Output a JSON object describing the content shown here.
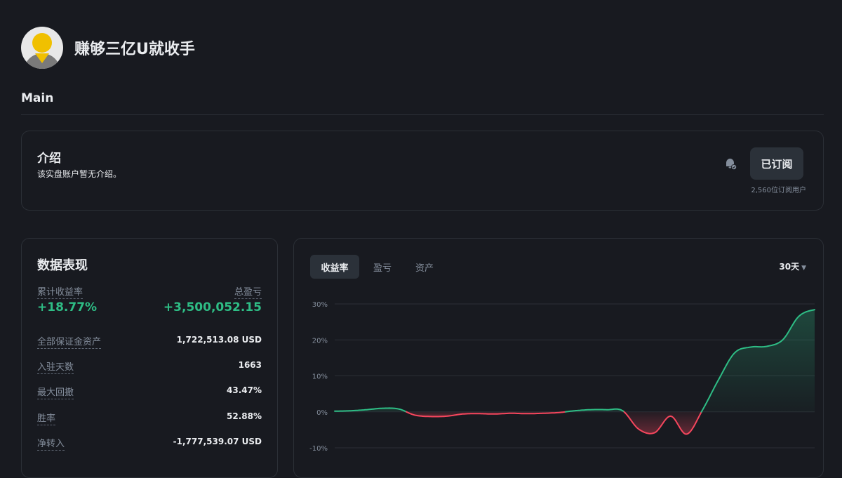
{
  "profile": {
    "name": "赚够三亿U就收手"
  },
  "section": {
    "title": "Main"
  },
  "intro": {
    "title": "介绍",
    "description": "该实盘账户暂无介绍。",
    "subscribe_label": "已订阅",
    "subscriber_count": "2,560位订阅用户"
  },
  "stats": {
    "title": "数据表现",
    "cumulative_return_label": "累计收益率",
    "cumulative_return_value": "+18.77%",
    "total_pnl_label": "总盈亏",
    "total_pnl_value": "+3,500,052.15",
    "rows": [
      {
        "label": "全部保证金资产",
        "value": "1,722,513.08 USD"
      },
      {
        "label": "入驻天数",
        "value": "1663"
      },
      {
        "label": "最大回撤",
        "value": "43.47%"
      },
      {
        "label": "胜率",
        "value": "52.88%"
      },
      {
        "label": "净转入",
        "value": "-1,777,539.07 USD"
      }
    ]
  },
  "chart_panel": {
    "tabs": [
      "收益率",
      "盈亏",
      "资产"
    ],
    "active_tab": 0,
    "period": "30天"
  },
  "colors": {
    "positive": "#2ebd85",
    "negative": "#f6465d",
    "background": "#181a20"
  },
  "chart_data": {
    "type": "area",
    "xlabel": "",
    "ylabel": "",
    "ylim": [
      -10,
      30
    ],
    "y_ticks": [
      "30%",
      "20%",
      "10%",
      "0%",
      "-10%"
    ],
    "y_tick_values": [
      30,
      20,
      10,
      0,
      -10
    ],
    "grid": true,
    "series": [
      {
        "values": [
          0.2,
          0.3,
          0.6,
          1.0,
          0.8,
          -0.9,
          -1.3,
          -1.2,
          -0.6,
          -0.5,
          -0.6,
          -0.4,
          -0.5,
          -0.4,
          -0.2,
          0.3,
          0.6,
          0.6,
          0.3,
          -4.8,
          -5.8,
          -1.2,
          -6.2,
          0.6,
          9.0,
          16.4,
          18.0,
          18.2,
          20.0,
          26.5,
          28.4
        ]
      }
    ]
  }
}
